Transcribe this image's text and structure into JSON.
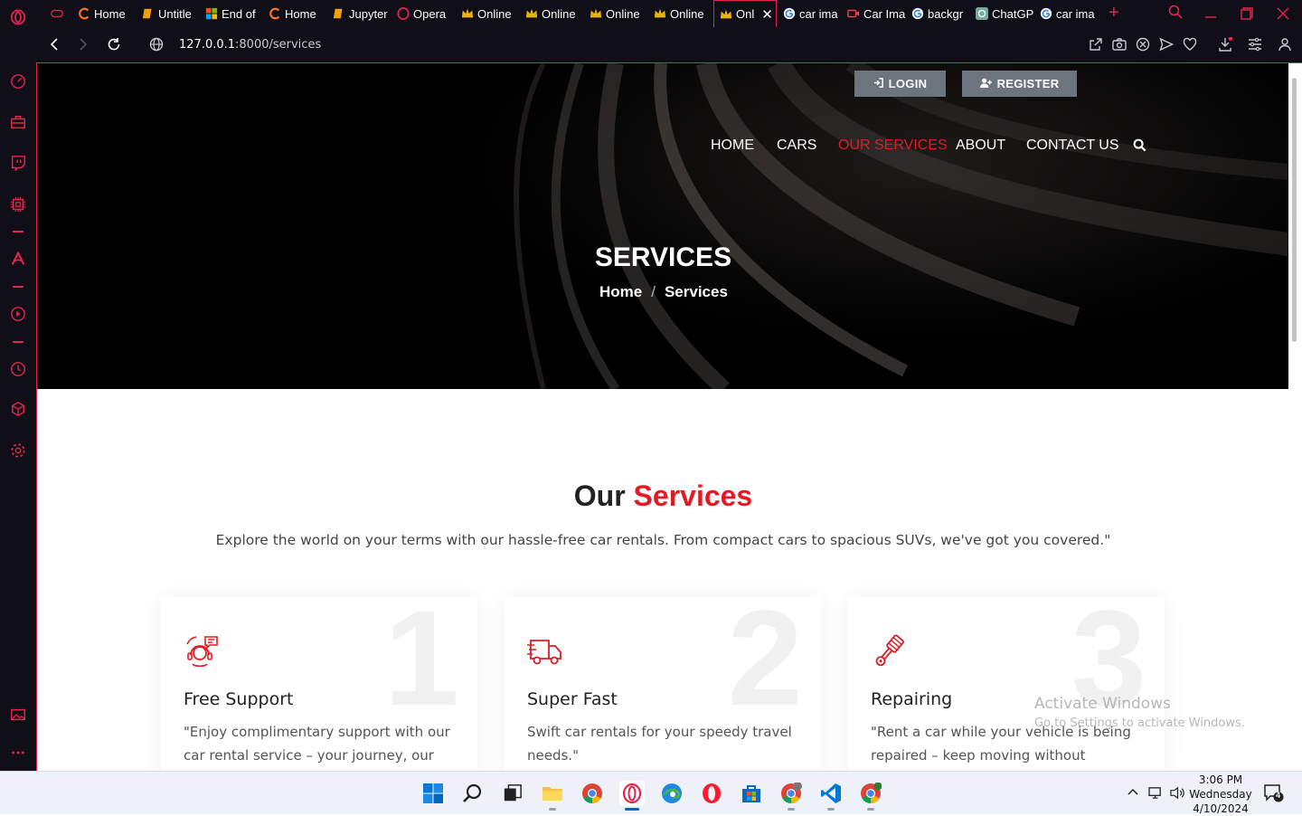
{
  "browser": {
    "tabs": [
      {
        "title": "Home",
        "favicon": "brand-c-icon"
      },
      {
        "title": "Untitle",
        "favicon": "notebook-icon"
      },
      {
        "title": "End of",
        "favicon": "windows-icon"
      },
      {
        "title": "Home",
        "favicon": "brand-c-icon"
      },
      {
        "title": "Jupyter",
        "favicon": "notebook-icon"
      },
      {
        "title": "Opera",
        "favicon": "opera-icon"
      },
      {
        "title": "Online",
        "favicon": "crown-icon"
      },
      {
        "title": "Online",
        "favicon": "crown-icon"
      },
      {
        "title": "Online",
        "favicon": "crown-icon"
      },
      {
        "title": "Online",
        "favicon": "crown-icon"
      },
      {
        "title": "Onl",
        "favicon": "crown-icon",
        "active": true
      },
      {
        "title": "car ima",
        "favicon": "google-icon"
      },
      {
        "title": "Car Ima",
        "favicon": "video-icon"
      },
      {
        "title": "backgr",
        "favicon": "google-icon"
      },
      {
        "title": "ChatGP",
        "favicon": "chatgpt-icon"
      },
      {
        "title": "car ima",
        "favicon": "google-icon"
      }
    ],
    "url_host": "127.0.0.1",
    "url_rest": ":8000/services",
    "accent": "#e5244e"
  },
  "page": {
    "auth": {
      "login": "LOGIN",
      "register": "REGISTER"
    },
    "nav": {
      "home": "HOME",
      "cars": "CARS",
      "services": "OUR SERVICES",
      "about": "ABOUT",
      "contact": "CONTACT US"
    },
    "hero": {
      "title": "SERVICES",
      "crumb_home": "Home",
      "crumb_sep": "/",
      "crumb_current": "Services"
    },
    "section": {
      "heading_plain": "Our",
      "heading_accent": "Services",
      "subtitle": "Explore the world on your terms with our hassle-free car rentals. From compact cars to spacious SUVs, we've got you covered.\""
    },
    "cards": [
      {
        "num": "1",
        "icon": "support-icon",
        "title": "Free Support",
        "text": "\"Enjoy complimentary support with our car rental service – your journey, our"
      },
      {
        "num": "2",
        "icon": "truck-icon",
        "title": "Super Fast",
        "text": "Swift car rentals for your speedy travel needs.\""
      },
      {
        "num": "3",
        "icon": "piston-icon",
        "title": "Repairing",
        "text": "\"Rent a car while your vehicle is being repaired – keep moving without"
      }
    ],
    "accent_color": "#e21b23"
  },
  "watermark": {
    "line1": "Activate Windows",
    "line2": "Go to Settings to activate Windows."
  },
  "taskbar": {
    "time": "3:06 PM",
    "day": "Wednesday",
    "date": "4/10/2024",
    "notification_count": "4"
  }
}
